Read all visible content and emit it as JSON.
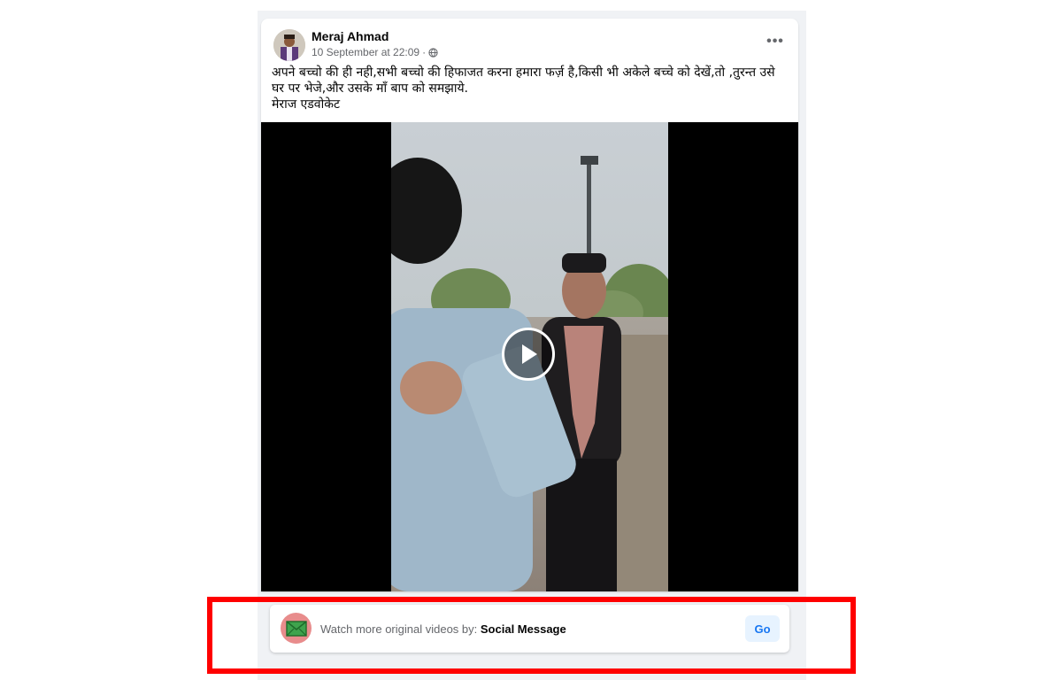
{
  "post": {
    "author": "Meraj Ahmad",
    "timestamp": "10 September at 22:09",
    "separator": "·",
    "privacy_icon": "globe-icon",
    "more_options": "•••",
    "text_lines": [
      "अपने बच्चो की ही नही,सभी बच्चो की हिफाजत करना हमारा फर्ज़ है,किसी भी अकेले बच्चे को देखें,तो ,तुरन्त उसे",
      "घर पर भेजे,और उसके माँ बाप को समझाये.",
      "मेराज एडवोकेट"
    ]
  },
  "video": {
    "play_icon": "play-icon"
  },
  "promo": {
    "icon": "envelope-icon",
    "prefix": "Watch more original videos by:",
    "channel": "Social Message",
    "button": "Go"
  },
  "colors": {
    "highlight": "#ff0000",
    "link_blue": "#1877f2",
    "button_bg": "#e7f3ff",
    "feed_bg": "#f0f2f5"
  }
}
